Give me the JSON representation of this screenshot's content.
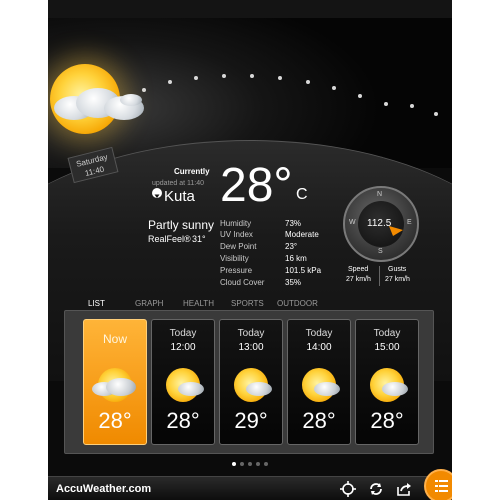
{
  "location": {
    "current_label": "Currently",
    "updated": "updated at 11:40",
    "city": "Kuta",
    "temperature": "28°",
    "unit": "C",
    "condition": "Partly sunny",
    "realfeel_label": "RealFeel®",
    "realfeel_value": "31°"
  },
  "daybadge": {
    "day": "Saturday",
    "time": "11:40"
  },
  "details": [
    {
      "label": "Humidity",
      "value": "73%"
    },
    {
      "label": "UV Index",
      "value": "Moderate"
    },
    {
      "label": "Dew Point",
      "value": "23°"
    },
    {
      "label": "Visibility",
      "value": "16 km"
    },
    {
      "label": "Pressure",
      "value": "101.5 kPa"
    },
    {
      "label": "Cloud Cover",
      "value": "35%"
    }
  ],
  "wind": {
    "direction_value": "112.5",
    "compass": {
      "n": "N",
      "s": "S",
      "e": "E",
      "w": "W"
    },
    "speed_label": "Speed",
    "speed_value": "27 km/h",
    "gusts_label": "Gusts",
    "gusts_value": "27 km/h"
  },
  "tabs": [
    "LIST",
    "GRAPH",
    "HEALTH",
    "SPORTS",
    "OUTDOOR"
  ],
  "hourly": [
    {
      "label": "Now",
      "time": "",
      "temp": "28°"
    },
    {
      "label": "Today",
      "time": "12:00",
      "temp": "28°"
    },
    {
      "label": "Today",
      "time": "13:00",
      "temp": "29°"
    },
    {
      "label": "Today",
      "time": "14:00",
      "temp": "28°"
    },
    {
      "label": "Today",
      "time": "15:00",
      "temp": "28°"
    }
  ],
  "footer": {
    "brand": "AccuWeather.com"
  },
  "icons": [
    "locate-icon",
    "refresh-icon",
    "share-icon",
    "menu-icon",
    "sun-cloud-icon",
    "location-pin-icon"
  ],
  "colors": {
    "accent": "#f28a00",
    "background": "#0b0b0b"
  }
}
